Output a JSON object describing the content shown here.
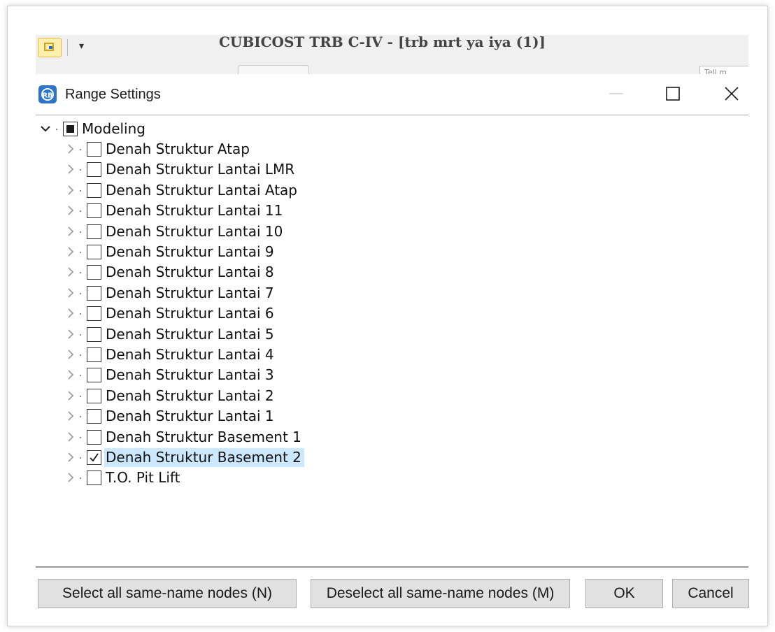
{
  "app": {
    "title": "CUBICOST TRB C-IV - [trb mrt ya iya (1)]",
    "quick_access": "▾",
    "tell_me": "Tell m"
  },
  "dialog": {
    "title": "Range Settings",
    "icon": "cubicost-app-icon"
  },
  "tree": {
    "root": {
      "label": "Modeling",
      "expanded": true,
      "check_state": "partial"
    },
    "items": [
      {
        "label": "Denah Struktur Atap",
        "checked": false
      },
      {
        "label": "Denah Struktur Lantai LMR",
        "checked": false
      },
      {
        "label": "Denah Struktur Lantai Atap",
        "checked": false
      },
      {
        "label": "Denah Struktur Lantai 11",
        "checked": false
      },
      {
        "label": "Denah Struktur Lantai 10",
        "checked": false
      },
      {
        "label": "Denah Struktur Lantai 9",
        "checked": false
      },
      {
        "label": "Denah Struktur Lantai 8",
        "checked": false
      },
      {
        "label": "Denah Struktur Lantai 7",
        "checked": false
      },
      {
        "label": "Denah Struktur Lantai 6",
        "checked": false
      },
      {
        "label": "Denah Struktur Lantai 5",
        "checked": false
      },
      {
        "label": "Denah Struktur Lantai 4",
        "checked": false
      },
      {
        "label": "Denah Struktur Lantai 3",
        "checked": false
      },
      {
        "label": "Denah Struktur Lantai 2",
        "checked": false
      },
      {
        "label": "Denah Struktur Lantai 1",
        "checked": false
      },
      {
        "label": "Denah Struktur Basement 1",
        "checked": false
      },
      {
        "label": "Denah Struktur Basement 2",
        "checked": true,
        "selected": true
      },
      {
        "label": "T.O. Pit Lift",
        "checked": false
      }
    ]
  },
  "buttons": {
    "select_all": "Select all same-name nodes (N)",
    "deselect_all": "Deselect all same-name nodes (M)",
    "ok": "OK",
    "cancel": "Cancel"
  },
  "colors": {
    "selection": "#cce8ff",
    "accent": "#2b74c9",
    "button_bg": "#e1e1e1"
  }
}
